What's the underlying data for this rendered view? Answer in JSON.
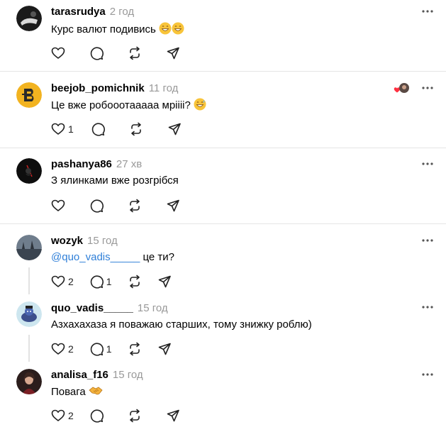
{
  "posts": [
    {
      "username": "tarasrudya",
      "time": "2 год",
      "text": "Курс валют подивись",
      "likes": "",
      "replies": ""
    },
    {
      "username": "beejob_pomichnik",
      "time": "11 год",
      "text": "Це вже робооотааааа мріііі?",
      "likes": "1",
      "replies": ""
    },
    {
      "username": "pashanya86",
      "time": "27 хв",
      "text": "З ялинками вже розгрібся",
      "likes": "",
      "replies": ""
    },
    {
      "username": "wozyk",
      "time": "15 год",
      "mention": "@quo_vadis_____",
      "text": " це ти?",
      "likes": "2",
      "replies": "1"
    },
    {
      "username": "quo_vadis_____",
      "time": "15 год",
      "text": "Азхахахаза я поважаю старших, тому знижку роблю)",
      "likes": "2",
      "replies": "1"
    },
    {
      "username": "analisa_f16",
      "time": "15 год",
      "text": "Повага",
      "likes": "2",
      "replies": ""
    }
  ],
  "colors": {
    "accent": "#2f7fd8",
    "muted": "#999999",
    "divider": "#e5e5e5",
    "like_heart": "#ff3040"
  },
  "icons": [
    "heart-icon",
    "comment-icon",
    "repost-icon",
    "share-icon",
    "more-icon"
  ]
}
